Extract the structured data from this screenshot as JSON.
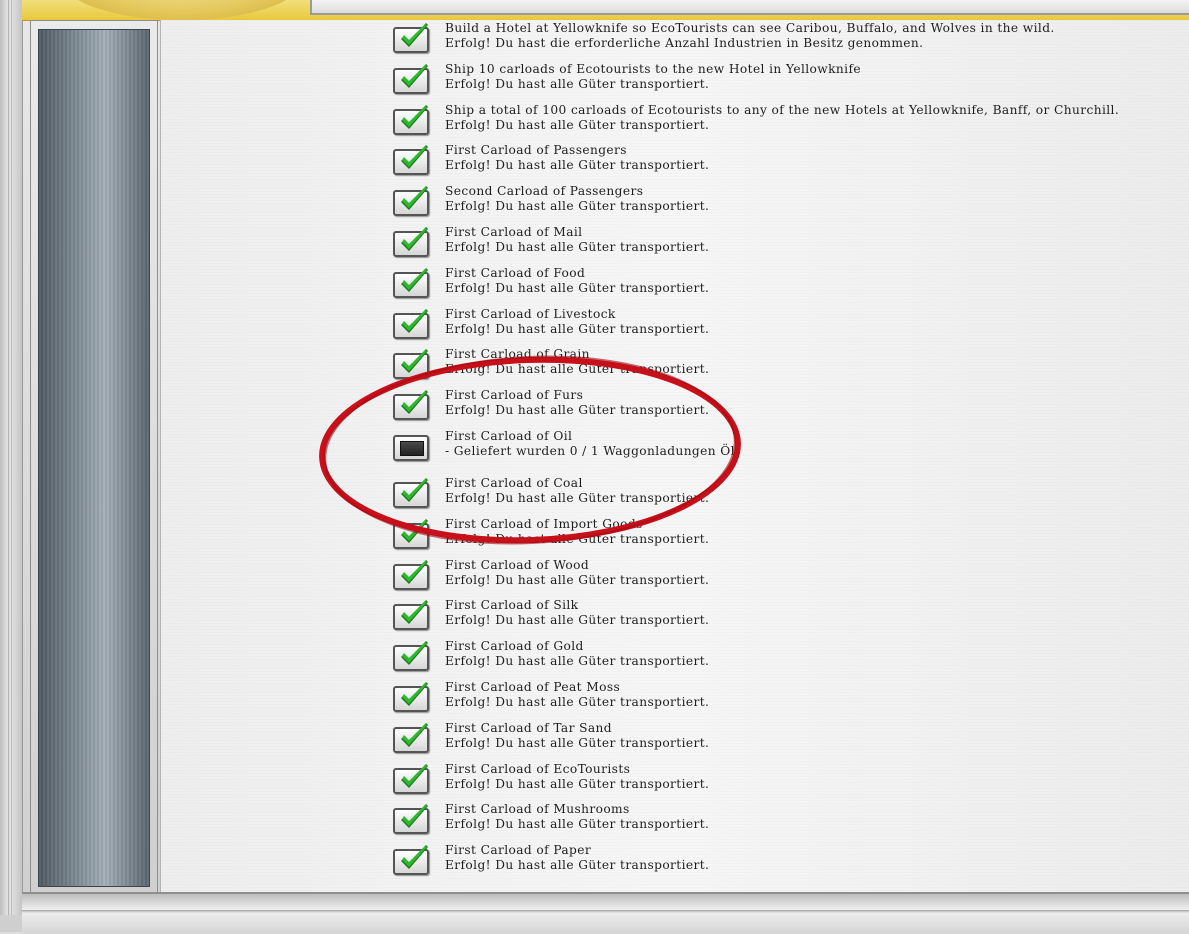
{
  "window": {
    "title": ""
  },
  "achievements": [
    {
      "title": "Build a Hotel at Yellowknife so EcoTourists can see Caribou, Buffalo, and Wolves in the wild.",
      "status": "Erfolg! Du hast die erforderliche Anzahl Industrien in Besitz genommen.",
      "completed": true
    },
    {
      "title": "Ship 10 carloads of Ecotourists to the new Hotel in Yellowknife",
      "status": "Erfolg! Du hast alle Güter transportiert.",
      "completed": true
    },
    {
      "title": "Ship a total of 100 carloads of Ecotourists to any of the new Hotels at Yellowknife, Banff, or Churchill.",
      "status": "Erfolg! Du hast alle Güter transportiert.",
      "completed": true
    },
    {
      "title": "First Carload of Passengers",
      "status": "Erfolg! Du hast alle Güter transportiert.",
      "completed": true
    },
    {
      "title": "Second Carload of Passengers",
      "status": "Erfolg! Du hast alle Güter transportiert.",
      "completed": true
    },
    {
      "title": "First Carload of Mail",
      "status": "Erfolg! Du hast alle Güter transportiert.",
      "completed": true
    },
    {
      "title": "First Carload of Food",
      "status": "Erfolg! Du hast alle Güter transportiert.",
      "completed": true
    },
    {
      "title": "First Carload of Livestock",
      "status": "Erfolg! Du hast alle Güter transportiert.",
      "completed": true
    },
    {
      "title": "First Carload of Grain",
      "status": "Erfolg! Du hast alle Güter transportiert.",
      "completed": true
    },
    {
      "title": "First Carload of Furs",
      "status": "Erfolg! Du hast alle Güter transportiert.",
      "completed": true
    },
    {
      "title": "First Carload of Oil",
      "status": "- Geliefert wurden 0 / 1 Waggonladungen Öl",
      "completed": false
    },
    {
      "title": "First Carload of Coal",
      "status": "Erfolg! Du hast alle Güter transportiert.",
      "completed": true
    },
    {
      "title": "First Carload of Import Goods",
      "status": "Erfolg! Du hast alle Güter transportiert.",
      "completed": true
    },
    {
      "title": "First Carload of Wood",
      "status": "Erfolg! Du hast alle Güter transportiert.",
      "completed": true
    },
    {
      "title": "First Carload of Silk",
      "status": "Erfolg! Du hast alle Güter transportiert.",
      "completed": true
    },
    {
      "title": "First Carload of Gold",
      "status": "Erfolg! Du hast alle Güter transportiert.",
      "completed": true
    },
    {
      "title": "First Carload of Peat Moss",
      "status": "Erfolg! Du hast alle Güter transportiert.",
      "completed": true
    },
    {
      "title": "First Carload of Tar Sand",
      "status": "Erfolg! Du hast alle Güter transportiert.",
      "completed": true
    },
    {
      "title": "First Carload of EcoTourists",
      "status": "Erfolg! Du hast alle Güter transportiert.",
      "completed": true
    },
    {
      "title": "First Carload of Mushrooms",
      "status": "Erfolg! Du hast alle Güter transportiert.",
      "completed": true
    },
    {
      "title": "First Carload of Paper",
      "status": "Erfolg! Du hast alle Güter transportiert.",
      "completed": true
    }
  ],
  "colors": {
    "check_green": "#2db82d",
    "highlight_red": "#c8101a",
    "header_gold": "#e8c83c"
  },
  "icons": {
    "completed": "green-checkmark-icon",
    "pending": "empty-checkbox-icon"
  }
}
